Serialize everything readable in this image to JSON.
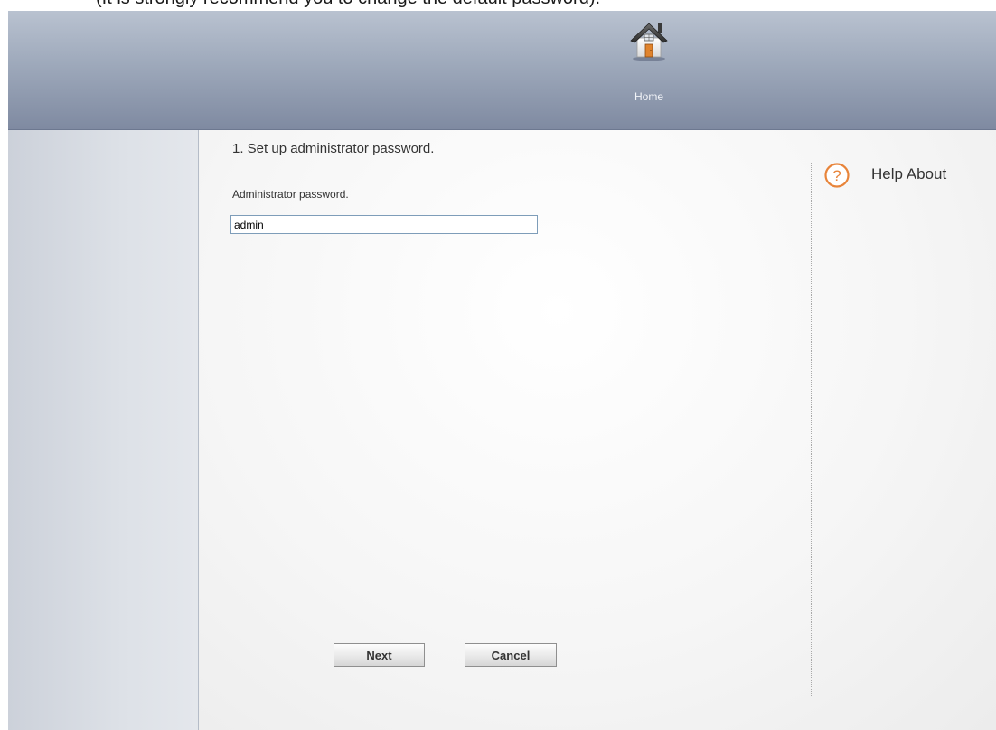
{
  "top_note": "(It is strongly recommend you to change the default password).",
  "nav": {
    "home_label": "Home",
    "home_icon": "home-icon"
  },
  "wizard": {
    "step_title": "1. Set up administrator password.",
    "password_label": "Administrator password.",
    "password_value": "admin"
  },
  "buttons": {
    "next_label": "Next",
    "cancel_label": "Cancel"
  },
  "help": {
    "label": "Help About",
    "icon": "help-icon",
    "accent_color": "#e8843a"
  }
}
